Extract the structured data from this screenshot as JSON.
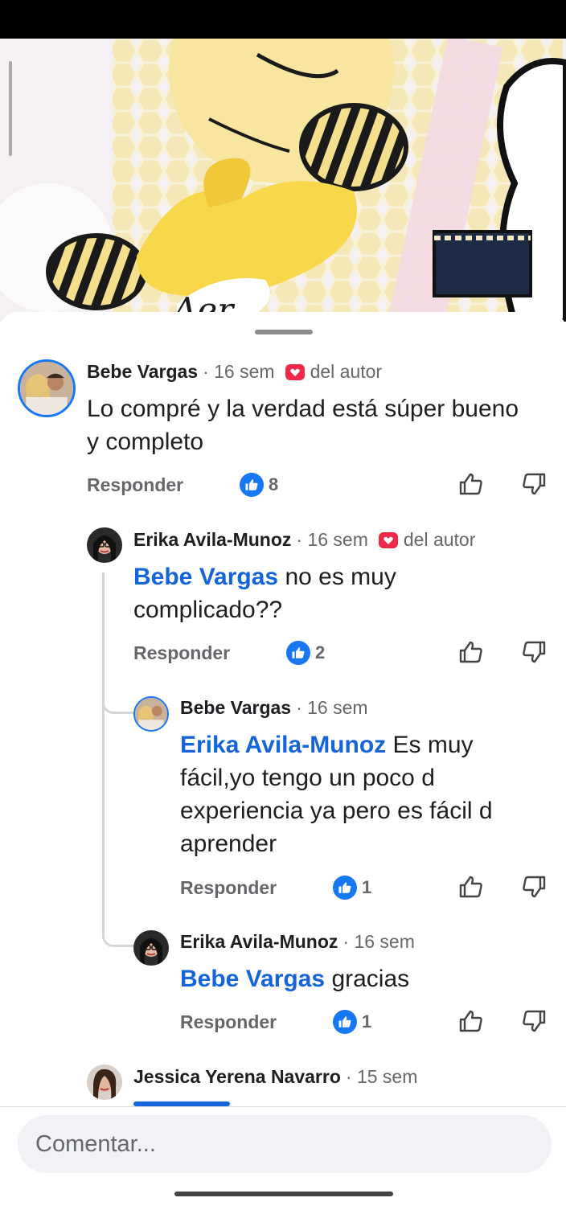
{
  "author_label": "del autor",
  "reply_label": "Responder",
  "comments": [
    {
      "name": "Bebe Vargas",
      "time": "· 16 sem",
      "text": "Lo compré y la verdad está súper bueno y completo",
      "likes": "8"
    },
    {
      "name": "Erika Avila-Munoz",
      "time": "· 16 sem",
      "mention": "Bebe Vargas",
      "text": " no es muy complicado??",
      "likes": "2"
    },
    {
      "name": "Bebe Vargas",
      "time": "· 16 sem",
      "mention": "Erika Avila-Munoz",
      "text": " Es muy fácil,yo tengo un poco d experiencia ya pero es fácil d aprender",
      "likes": "1"
    },
    {
      "name": "Erika Avila-Munoz",
      "time": "· 16 sem",
      "mention": "Bebe Vargas",
      "text": " gracias",
      "likes": "1"
    },
    {
      "name": "Jessica Yerena Navarro",
      "time": "· 15 sem"
    }
  ],
  "composer": {
    "placeholder": "Comentar..."
  },
  "colors": {
    "accent": "#1877f2",
    "mention": "#1664d9",
    "heart": "#f02849",
    "muted": "#65676b"
  }
}
